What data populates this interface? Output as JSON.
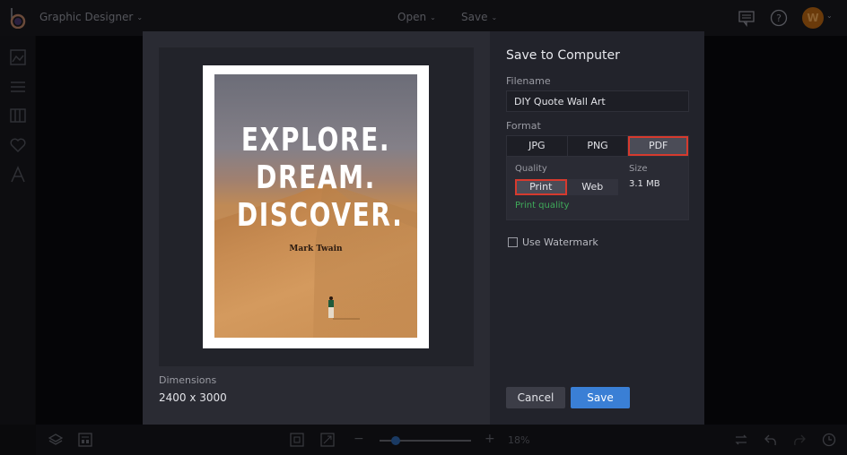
{
  "topbar": {
    "app_title": "Graphic Designer",
    "menus": [
      {
        "label": "Open"
      },
      {
        "label": "Save"
      }
    ],
    "icons": [
      "chat-icon",
      "help-icon"
    ],
    "avatar_initial": "W"
  },
  "sidebar": {
    "icons": [
      "image-icon",
      "adjustments-icon",
      "layout-icon",
      "heart-icon",
      "text-icon"
    ]
  },
  "bottombar": {
    "zoom_minus": "−",
    "zoom_plus": "+",
    "zoom_label": "18%",
    "zoom_percent": 18
  },
  "modal": {
    "preview": {
      "quote_lines": [
        "EXPLORE.",
        "DREAM.",
        "DISCOVER."
      ],
      "author": "Mark Twain",
      "dimensions_label": "Dimensions",
      "dimensions_value": "2400 x 3000"
    },
    "options": {
      "title": "Save to Computer",
      "filename_label": "Filename",
      "filename_value": "DIY Quote Wall Art",
      "format_label": "Format",
      "formats": [
        {
          "label": "JPG",
          "active": false
        },
        {
          "label": "PNG",
          "active": false
        },
        {
          "label": "PDF",
          "active": true
        }
      ],
      "quality_label": "Quality",
      "qualities": [
        {
          "label": "Print",
          "active": true
        },
        {
          "label": "Web",
          "active": false
        }
      ],
      "quality_note": "Print quality",
      "size_label": "Size",
      "size_value": "3.1 MB",
      "watermark_label": "Use Watermark",
      "watermark_checked": false,
      "cancel_label": "Cancel",
      "save_label": "Save"
    }
  },
  "colors": {
    "accent": "#3a7fd5",
    "highlight": "#d63a2e",
    "success": "#3faa5a"
  }
}
